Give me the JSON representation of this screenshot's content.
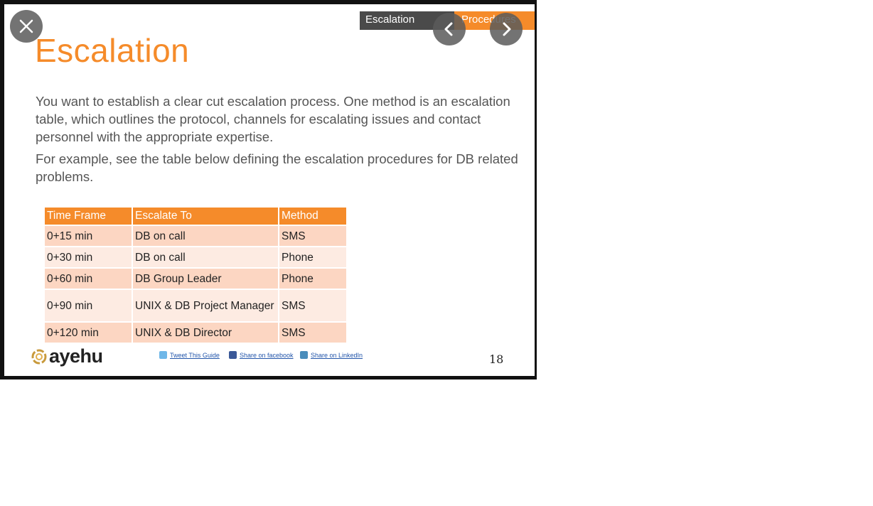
{
  "slide": {
    "tabs": [
      {
        "label": "Escalation"
      },
      {
        "label": "Procedures"
      }
    ],
    "title": "Escalation",
    "paragraphs": [
      "You want to establish a clear cut escalation process. One method is an escalation table, which outlines the protocol, channels for escalating issues and contact personnel with the appropriate expertise.",
      "For example, see the table below defining the escalation procedures for DB related problems."
    ],
    "table": {
      "headers": [
        "Time Frame",
        "Escalate To",
        "Method"
      ],
      "rows": [
        [
          "0+15 min",
          "DB on call",
          "SMS"
        ],
        [
          "0+30 min",
          "DB on call",
          "Phone"
        ],
        [
          "0+60 min",
          "DB Group Leader",
          "Phone"
        ],
        [
          "0+90 min",
          "UNIX & DB Project Manager",
          "SMS"
        ],
        [
          "0+120 min",
          "UNIX & DB Director",
          "SMS"
        ]
      ]
    },
    "footer": {
      "logo_text": "ayehu",
      "share_twitter": "Tweet This Guide",
      "share_facebook": "Share on facebook",
      "share_linkedin": "Share on LinkedIn",
      "page_number": "18"
    }
  },
  "colors": {
    "accent": "#f58b2a",
    "dark_tab": "#4a4a4a",
    "row_odd": "#fcd6c2",
    "row_even": "#fdebe2"
  },
  "icons": {
    "close": "close-icon",
    "prev": "chevron-left-icon",
    "next": "chevron-right-icon",
    "twitter": "twitter-icon",
    "facebook": "facebook-icon",
    "linkedin": "linkedin-icon",
    "logo": "logo-mark-icon"
  }
}
